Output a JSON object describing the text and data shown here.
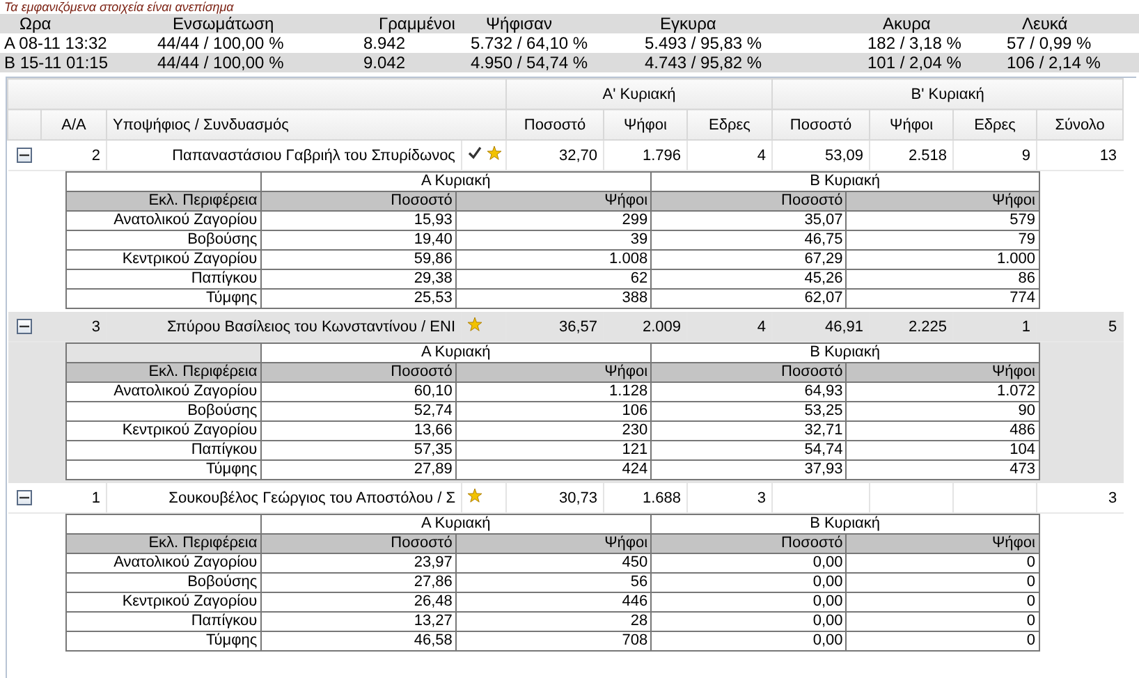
{
  "notice": "Τα εμφανιζόμενα στοιχεία είναι ανεπίσημα",
  "summary": {
    "columns": [
      "Ωρα",
      "Ενσωμάτωση",
      "Γραμμένοι",
      "Ψήφισαν",
      "Εγκυρα",
      "Ακυρα",
      "Λευκά"
    ],
    "rows": [
      [
        "Α 08-11 13:32",
        "44/44 / 100,00 %",
        "8.942",
        "5.732 / 64,10 %",
        "5.493 / 95,83 %",
        "182 / 3,18 %",
        "57 / 0,99 %"
      ],
      [
        "Β 15-11 01:15",
        "44/44 / 100,00 %",
        "9.042",
        "4.950 / 54,74 %",
        "4.743 / 95,82 %",
        "101 / 2,04 %",
        "106 / 2,14 %"
      ]
    ]
  },
  "grid": {
    "groups": [
      "Α' Κυριακή",
      "Β' Κυριακή"
    ],
    "columns": [
      "Α/Α",
      "Υποψήφιος / Συνδυασμός",
      "Ποσοστό",
      "Ψήφοι",
      "Εδρες",
      "Ποσοστό",
      "Ψήφοι",
      "Εδρες",
      "Σύνολο"
    ]
  },
  "candidates": [
    {
      "expanded": true,
      "selected": false,
      "elected": true,
      "starred": true,
      "aa": "2",
      "name": "Παπαναστάσιου Γαβριήλ του Σπυρίδωνος",
      "cells": [
        "32,70",
        "1.796",
        "4",
        "53,09",
        "2.518",
        "9"
      ],
      "total": "13",
      "detail": {
        "groups": [
          "Α Κυριακή",
          "Β Κυριακή"
        ],
        "columns": [
          "Εκλ. Περιφέρεια",
          "Ποσοστό",
          "Ψήφοι",
          "Ποσοστό",
          "Ψήφοι"
        ],
        "rows": [
          [
            "Ανατολικού Ζαγορίου",
            "15,93",
            "299",
            "35,07",
            "579"
          ],
          [
            "Βοβούσης",
            "19,40",
            "39",
            "46,75",
            "79"
          ],
          [
            "Κεντρικού Ζαγορίου",
            "59,86",
            "1.008",
            "67,29",
            "1.000"
          ],
          [
            "Παπίγκου",
            "29,38",
            "62",
            "45,26",
            "86"
          ],
          [
            "Τύμφης",
            "25,53",
            "388",
            "62,07",
            "774"
          ]
        ]
      }
    },
    {
      "expanded": true,
      "selected": true,
      "elected": false,
      "starred": true,
      "aa": "3",
      "name": "Σπύρου Βασίλειος του Κωνσταντίνου / ΕΝΙ",
      "cells": [
        "36,57",
        "2.009",
        "4",
        "46,91",
        "2.225",
        "1"
      ],
      "total": "5",
      "detail": {
        "groups": [
          "Α Κυριακή",
          "Β Κυριακή"
        ],
        "columns": [
          "Εκλ. Περιφέρεια",
          "Ποσοστό",
          "Ψήφοι",
          "Ποσοστό",
          "Ψήφοι"
        ],
        "rows": [
          [
            "Ανατολικού Ζαγορίου",
            "60,10",
            "1.128",
            "64,93",
            "1.072"
          ],
          [
            "Βοβούσης",
            "52,74",
            "106",
            "53,25",
            "90"
          ],
          [
            "Κεντρικού Ζαγορίου",
            "13,66",
            "230",
            "32,71",
            "486"
          ],
          [
            "Παπίγκου",
            "57,35",
            "121",
            "54,74",
            "104"
          ],
          [
            "Τύμφης",
            "27,89",
            "424",
            "37,93",
            "473"
          ]
        ]
      }
    },
    {
      "expanded": true,
      "selected": false,
      "elected": false,
      "starred": true,
      "aa": "1",
      "name": "Σουκουβέλος Γεώργιος του Αποστόλου / Σ",
      "cells": [
        "30,73",
        "1.688",
        "3",
        null,
        null,
        null
      ],
      "total": "3",
      "detail": {
        "groups": [
          "Α Κυριακή",
          "Β Κυριακή"
        ],
        "columns": [
          "Εκλ. Περιφέρεια",
          "Ποσοστό",
          "Ψήφοι",
          "Ποσοστό",
          "Ψήφοι"
        ],
        "rows": [
          [
            "Ανατολικού Ζαγορίου",
            "23,97",
            "450",
            "0,00",
            "0"
          ],
          [
            "Βοβούσης",
            "27,86",
            "56",
            "0,00",
            "0"
          ],
          [
            "Κεντρικού Ζαγορίου",
            "26,48",
            "446",
            "0,00",
            "0"
          ],
          [
            "Παπίγκου",
            "13,27",
            "28",
            "0,00",
            "0"
          ],
          [
            "Τύμφης",
            "46,58",
            "708",
            "0,00",
            "0"
          ]
        ]
      }
    }
  ]
}
